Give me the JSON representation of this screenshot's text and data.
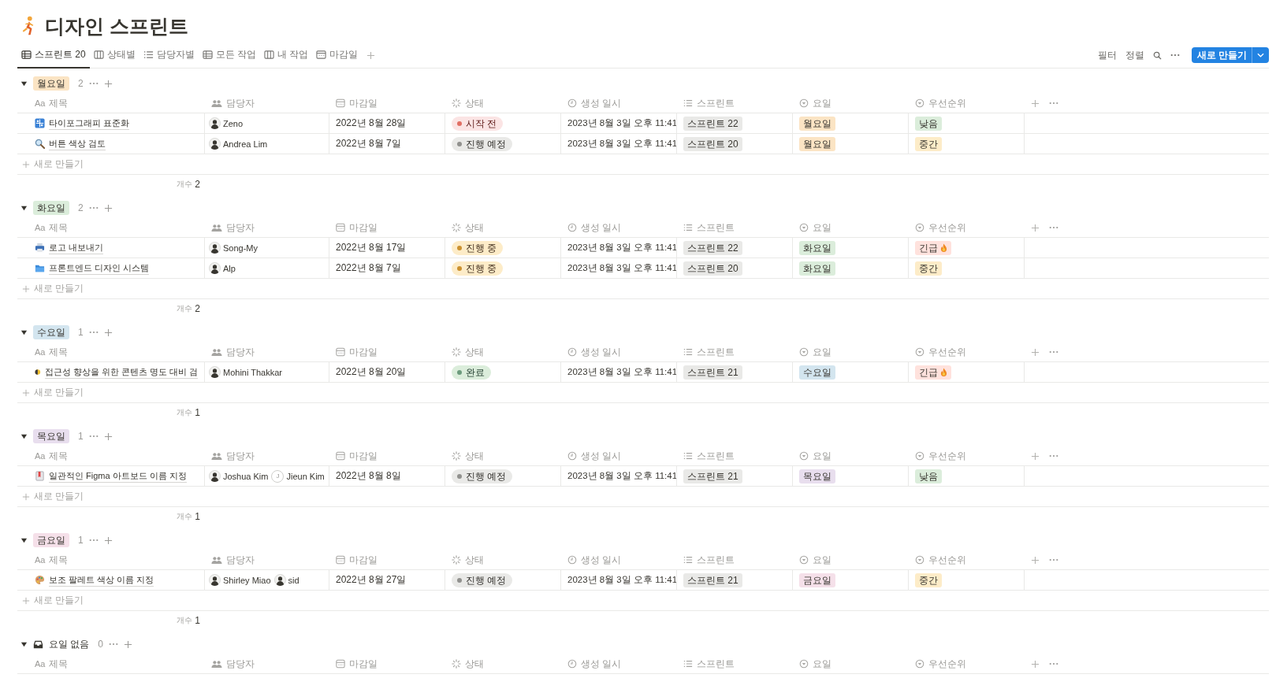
{
  "page": {
    "title": "디자인 스프린트"
  },
  "views": [
    {
      "label": "스프린트 20",
      "kind": "table",
      "selected": true
    },
    {
      "label": "상태별",
      "kind": "board",
      "selected": false
    },
    {
      "label": "담당자별",
      "kind": "list",
      "selected": false
    },
    {
      "label": "모든 작업",
      "kind": "table",
      "selected": false
    },
    {
      "label": "내 작업",
      "kind": "board",
      "selected": false
    },
    {
      "label": "마감일",
      "kind": "calendar",
      "selected": false
    }
  ],
  "toolbar": {
    "filter": "필터",
    "sort": "정렬",
    "new_button": "새로 만들기"
  },
  "groups": [
    {
      "kind": "tag",
      "label": "월요일",
      "color": "#fbe4c4",
      "count": "2",
      "columns": [
        {
          "kind": "title",
          "icon_text": "Aa",
          "label": "제목"
        },
        {
          "kind": "person",
          "label": "담당자"
        },
        {
          "kind": "date",
          "label": "마감일"
        },
        {
          "kind": "status",
          "label": "상태"
        },
        {
          "kind": "created",
          "label": "생성 일시"
        },
        {
          "kind": "multi",
          "label": "스프린트"
        },
        {
          "kind": "select",
          "label": "요일"
        },
        {
          "kind": "select",
          "label": "우선순위"
        }
      ],
      "rows": [
        {
          "kind": "grid",
          "title": "타이포그래피 표준화",
          "assignees": [
            {
              "name": "Zeno"
            }
          ],
          "due": "2022년 8월 28일",
          "status": {
            "label": "시작 전",
            "kind": "not_started"
          },
          "created": "2023년 8월 3일 오후 11:41",
          "sprint": "스프린트 22",
          "day": {
            "label": "월요일",
            "color": "#fbe4c4"
          },
          "priority": {
            "label": "낮음",
            "color": "#dbeddb",
            "flame": false
          }
        },
        {
          "kind": "magnifier",
          "title": "버튼 색상 검토",
          "assignees": [
            {
              "name": "Andrea Lim"
            }
          ],
          "due": "2022년 8월 7일",
          "status": {
            "label": "진행 예정",
            "kind": "planned"
          },
          "created": "2023년 8월 3일 오후 11:41",
          "sprint": "스프린트 20",
          "day": {
            "label": "월요일",
            "color": "#fbe4c4"
          },
          "priority": {
            "label": "중간",
            "color": "#fdecc8",
            "flame": false
          }
        }
      ],
      "new_row": "새로 만들기",
      "count_label": "개수",
      "count_value": "2"
    },
    {
      "kind": "tag",
      "label": "화요일",
      "color": "#dbeddb",
      "count": "2",
      "columns": [
        {
          "kind": "title",
          "icon_text": "Aa",
          "label": "제목"
        },
        {
          "kind": "person",
          "label": "담당자"
        },
        {
          "kind": "date",
          "label": "마감일"
        },
        {
          "kind": "status",
          "label": "상태"
        },
        {
          "kind": "created",
          "label": "생성 일시"
        },
        {
          "kind": "multi",
          "label": "스프린트"
        },
        {
          "kind": "select",
          "label": "요일"
        },
        {
          "kind": "select",
          "label": "우선순위"
        }
      ],
      "rows": [
        {
          "kind": "printer",
          "title": "로고 내보내기",
          "assignees": [
            {
              "name": "Song-My"
            }
          ],
          "due": "2022년 8월 17일",
          "status": {
            "label": "진행 중",
            "kind": "in_progress"
          },
          "created": "2023년 8월 3일 오후 11:41",
          "sprint": "스프린트 22",
          "day": {
            "label": "화요일",
            "color": "#dbeddb"
          },
          "priority": {
            "label": "긴급",
            "color": "#ffe2dd",
            "flame": true
          }
        },
        {
          "kind": "folder",
          "title": "프론트엔드 디자인 시스템",
          "assignees": [
            {
              "name": "Alp"
            }
          ],
          "due": "2022년 8월 7일",
          "status": {
            "label": "진행 중",
            "kind": "in_progress"
          },
          "created": "2023년 8월 3일 오후 11:41",
          "sprint": "스프린트 20",
          "day": {
            "label": "화요일",
            "color": "#dbeddb"
          },
          "priority": {
            "label": "중간",
            "color": "#fdecc8",
            "flame": false
          }
        }
      ],
      "new_row": "새로 만들기",
      "count_label": "개수",
      "count_value": "2"
    },
    {
      "kind": "tag",
      "label": "수요일",
      "color": "#d3e5ef",
      "count": "1",
      "columns": [
        {
          "kind": "title",
          "icon_text": "Aa",
          "label": "제목"
        },
        {
          "kind": "person",
          "label": "담당자"
        },
        {
          "kind": "date",
          "label": "마감일"
        },
        {
          "kind": "status",
          "label": "상태"
        },
        {
          "kind": "created",
          "label": "생성 일시"
        },
        {
          "kind": "multi",
          "label": "스프린트"
        },
        {
          "kind": "select",
          "label": "요일"
        },
        {
          "kind": "select",
          "label": "우선순위"
        }
      ],
      "rows": [
        {
          "kind": "halfmoon",
          "title": "접근성 향상을 위한 콘텐츠 명도 대비 검",
          "assignees": [
            {
              "name": "Mohini Thakkar"
            }
          ],
          "due": "2022년 8월 20일",
          "status": {
            "label": "완료",
            "kind": "done"
          },
          "created": "2023년 8월 3일 오후 11:41",
          "sprint": "스프린트 21",
          "day": {
            "label": "수요일",
            "color": "#d3e5ef"
          },
          "priority": {
            "label": "긴급",
            "color": "#ffe2dd",
            "flame": true
          }
        }
      ],
      "new_row": "새로 만들기",
      "count_label": "개수",
      "count_value": "1"
    },
    {
      "kind": "tag",
      "label": "목요일",
      "color": "#e8deee",
      "count": "1",
      "columns": [
        {
          "kind": "title",
          "icon_text": "Aa",
          "label": "제목"
        },
        {
          "kind": "person",
          "label": "담당자"
        },
        {
          "kind": "date",
          "label": "마감일"
        },
        {
          "kind": "status",
          "label": "상태"
        },
        {
          "kind": "created",
          "label": "생성 일시"
        },
        {
          "kind": "multi",
          "label": "스프린트"
        },
        {
          "kind": "select",
          "label": "요일"
        },
        {
          "kind": "select",
          "label": "우선순위"
        }
      ],
      "rows": [
        {
          "kind": "bookmark",
          "title": "일관적인 Figma 아트보드 이름 지정",
          "assignees": [
            {
              "name": "Joshua Kim"
            },
            {
              "name": "Jieun Kim",
              "initial": "J"
            }
          ],
          "due": "2022년 8월 8일",
          "status": {
            "label": "진행 예정",
            "kind": "planned"
          },
          "created": "2023년 8월 3일 오후 11:41",
          "sprint": "스프린트 21",
          "day": {
            "label": "목요일",
            "color": "#e8deee"
          },
          "priority": {
            "label": "낮음",
            "color": "#dbeddb",
            "flame": false
          }
        }
      ],
      "new_row": "새로 만들기",
      "count_label": "개수",
      "count_value": "1"
    },
    {
      "kind": "tag",
      "label": "금요일",
      "color": "#f5e0e9",
      "count": "1",
      "columns": [
        {
          "kind": "title",
          "icon_text": "Aa",
          "label": "제목"
        },
        {
          "kind": "person",
          "label": "담당자"
        },
        {
          "kind": "date",
          "label": "마감일"
        },
        {
          "kind": "status",
          "label": "상태"
        },
        {
          "kind": "created",
          "label": "생성 일시"
        },
        {
          "kind": "multi",
          "label": "스프린트"
        },
        {
          "kind": "select",
          "label": "요일"
        },
        {
          "kind": "select",
          "label": "우선순위"
        }
      ],
      "rows": [
        {
          "kind": "palette",
          "title": "보조 팔레트 색상 이름 지정",
          "assignees": [
            {
              "name": "Shirley Miao"
            },
            {
              "name": "sid"
            }
          ],
          "due": "2022년 8월 27일",
          "status": {
            "label": "진행 예정",
            "kind": "planned"
          },
          "created": "2023년 8월 3일 오후 11:41",
          "sprint": "스프린트 21",
          "day": {
            "label": "금요일",
            "color": "#f5e0e9"
          },
          "priority": {
            "label": "중간",
            "color": "#fdecc8",
            "flame": false
          }
        }
      ],
      "new_row": "새로 만들기",
      "count_label": "개수",
      "count_value": "1"
    },
    {
      "kind": "none",
      "label": "요일 없음",
      "count": "0",
      "columns": [
        {
          "kind": "title",
          "icon_text": "Aa",
          "label": "제목"
        },
        {
          "kind": "person",
          "label": "담당자"
        },
        {
          "kind": "date",
          "label": "마감일"
        },
        {
          "kind": "status",
          "label": "상태"
        },
        {
          "kind": "created",
          "label": "생성 일시"
        },
        {
          "kind": "multi",
          "label": "스프린트"
        },
        {
          "kind": "select",
          "label": "요일"
        },
        {
          "kind": "select",
          "label": "우선순위"
        }
      ]
    }
  ]
}
